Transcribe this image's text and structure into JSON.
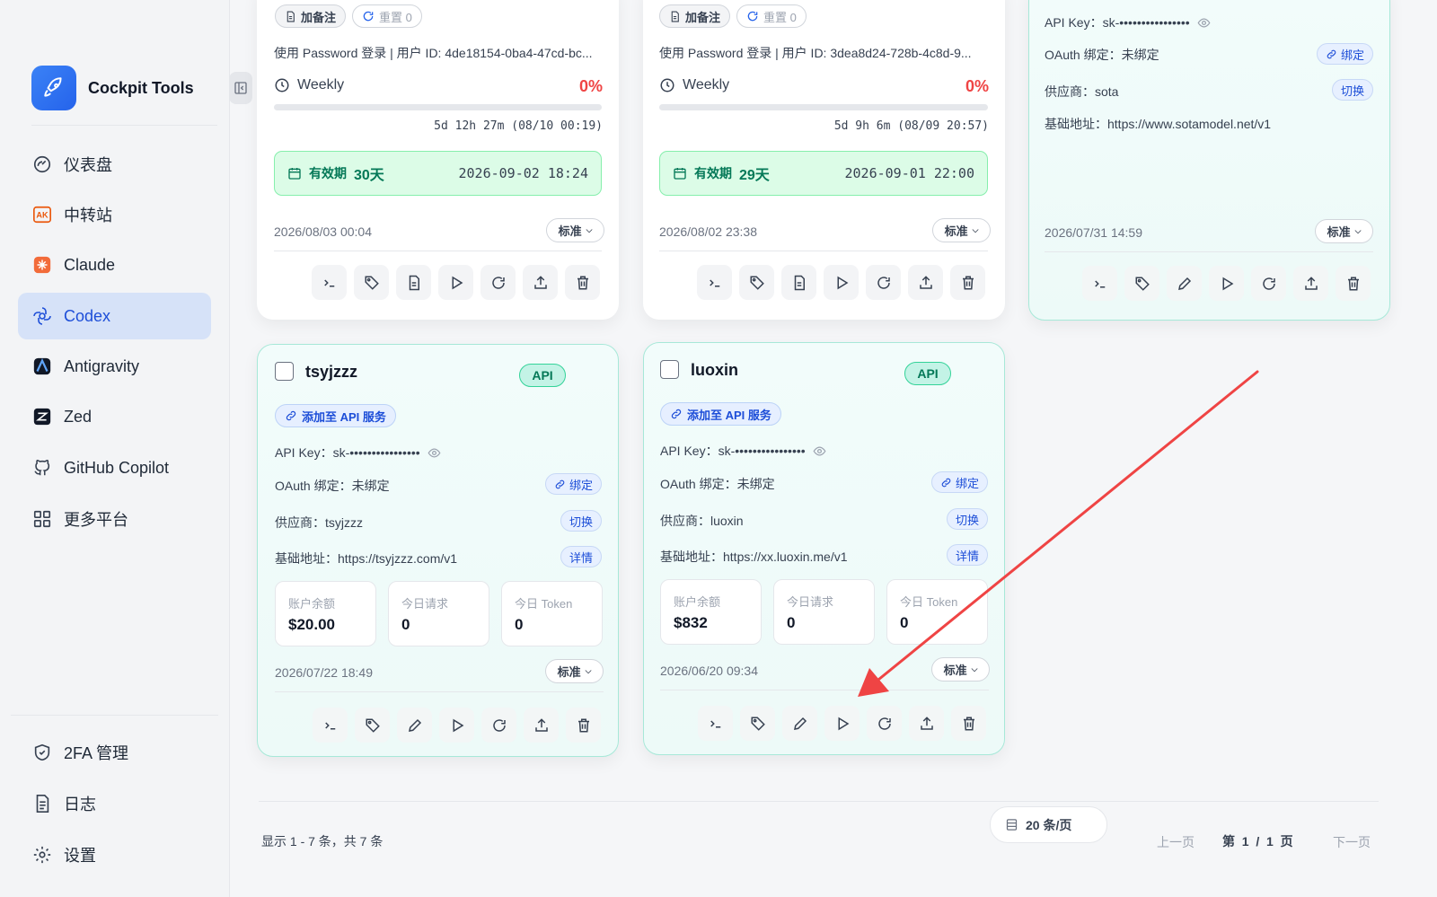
{
  "app": {
    "name": "Cockpit Tools"
  },
  "nav": {
    "items": [
      {
        "label": "仪表盘",
        "icon": "dashboard-icon"
      },
      {
        "label": "中转站",
        "icon": "ak-icon"
      },
      {
        "label": "Claude",
        "icon": "claude-icon"
      },
      {
        "label": "Codex",
        "icon": "openai-icon",
        "active": true
      },
      {
        "label": "Antigravity",
        "icon": "antigravity-icon"
      },
      {
        "label": "Zed",
        "icon": "zed-icon"
      },
      {
        "label": "GitHub Copilot",
        "icon": "github-icon"
      },
      {
        "label": "更多平台",
        "icon": "grid-icon"
      }
    ],
    "bottom": [
      {
        "label": "2FA 管理",
        "icon": "shield-icon"
      },
      {
        "label": "日志",
        "icon": "log-icon"
      },
      {
        "label": "设置",
        "icon": "gear-icon"
      }
    ]
  },
  "cards": {
    "c1": {
      "note": "加备注",
      "reset": "重置 0",
      "login": "使用 Password 登录 | 用户 ID: 4de18154-0ba4-47cd-bc...",
      "period": "Weekly",
      "pct": "0%",
      "reset_time": "5d 12h 27m (08/10 00:19)",
      "validity_label": "有效期",
      "validity_days": "30天",
      "validity_date": "2026-09-02 18:24",
      "created": "2026/08/03 00:04",
      "tier": "标准"
    },
    "c2": {
      "note": "加备注",
      "reset": "重置 0",
      "login": "使用 Password 登录 | 用户 ID: 3dea8d24-728b-4c8d-9...",
      "period": "Weekly",
      "pct": "0%",
      "reset_time": "5d 9h 6m (08/09 20:57)",
      "validity_label": "有效期",
      "validity_days": "29天",
      "validity_date": "2026-09-01 22:00",
      "created": "2026/08/02 23:38",
      "tier": "标准"
    },
    "c3": {
      "api_key": "API Key：sk-••••••••••••••••",
      "oauth": "OAuth 绑定：未绑定",
      "bind": "绑定",
      "provider": "供应商：sota",
      "switch": "切换",
      "base_url": "基础地址：https://www.sotamodel.net/v1",
      "created": "2026/07/31 14:59",
      "tier": "标准"
    },
    "c4": {
      "title": "tsyjzzz",
      "badge": "API",
      "add_api": "添加至 API 服务",
      "api_key": "API Key：sk-••••••••••••••••",
      "oauth": "OAuth 绑定：未绑定",
      "bind": "绑定",
      "provider": "供应商：tsyjzzz",
      "switch": "切换",
      "base_url": "基础地址：https://tsyjzzz.com/v1",
      "detail": "详情",
      "balance_label": "账户余额",
      "balance": "$20.00",
      "req_label": "今日请求",
      "req": "0",
      "token_label": "今日 Token",
      "token": "0",
      "created": "2026/07/22 18:49",
      "tier": "标准"
    },
    "c5": {
      "title": "luoxin",
      "badge": "API",
      "add_api": "添加至 API 服务",
      "api_key": "API Key：sk-••••••••••••••••",
      "oauth": "OAuth 绑定：未绑定",
      "bind": "绑定",
      "provider": "供应商：luoxin",
      "switch": "切换",
      "base_url": "基础地址：https://xx.luoxin.me/v1",
      "detail": "详情",
      "balance_label": "账户余额",
      "balance": "$832",
      "req_label": "今日请求",
      "req": "0",
      "token_label": "今日 Token",
      "token": "0",
      "created": "2026/06/20 09:34",
      "tier": "标准"
    }
  },
  "footer": {
    "summary": "显示 1 - 7 条，共 7 条",
    "per_page": "20 条/页",
    "prev": "上一页",
    "page_info": "第  1  /  1  页",
    "next": "下一页"
  },
  "colors": {
    "accent": "#1d4ed8",
    "api_green": "#047857",
    "danger": "#ef4444",
    "arrow": "#ef4444"
  }
}
